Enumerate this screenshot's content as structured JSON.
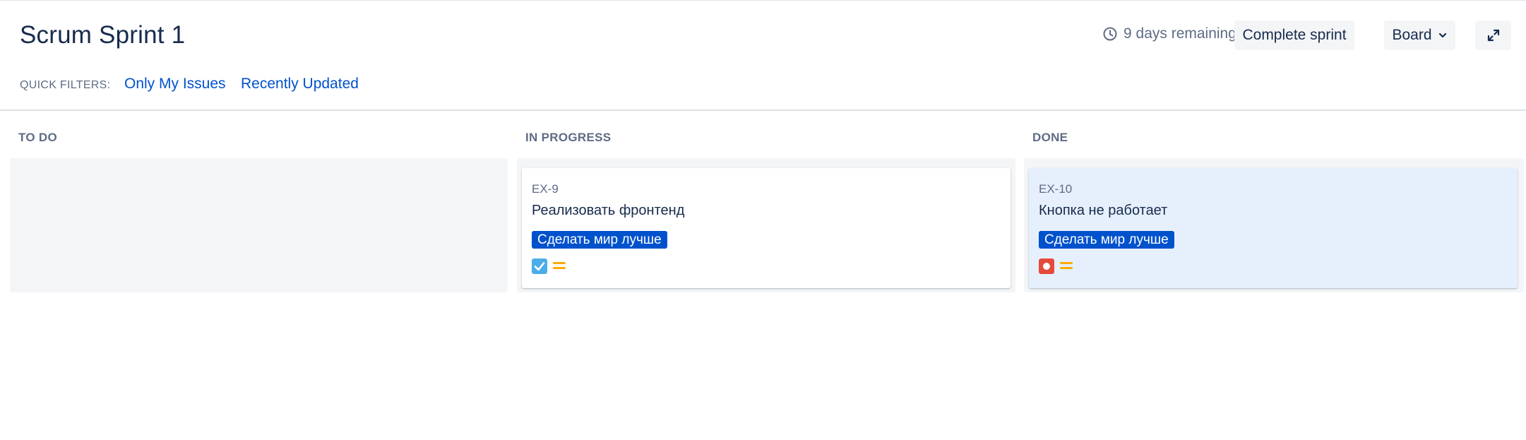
{
  "header": {
    "title": "Scrum Sprint 1",
    "remaining": "9 days remaining",
    "complete_label": "Complete sprint",
    "board_label": "Board"
  },
  "quick_filters": {
    "label": "QUICK FILTERS:",
    "items": [
      "Only My Issues",
      "Recently Updated"
    ]
  },
  "columns": [
    {
      "title": "TO DO",
      "cards": []
    },
    {
      "title": "IN PROGRESS",
      "cards": [
        {
          "key": "EX-9",
          "summary": "Реализовать фронтенд",
          "epic": "Сделать мир лучше",
          "type_icon": "task-checkbox-icon",
          "priority_icon": "priority-medium-icon"
        }
      ]
    },
    {
      "title": "DONE",
      "cards": [
        {
          "key": "EX-10",
          "summary": "Кнопка не работает",
          "epic": "Сделать мир лучше",
          "type_icon": "bug-icon",
          "priority_icon": "priority-medium-icon"
        }
      ]
    }
  ],
  "colors": {
    "epic_bg": "#0052cc",
    "task": "#4bade8",
    "bug": "#e5493a",
    "priority_medium": "#ffab00",
    "link": "#0052cc"
  }
}
